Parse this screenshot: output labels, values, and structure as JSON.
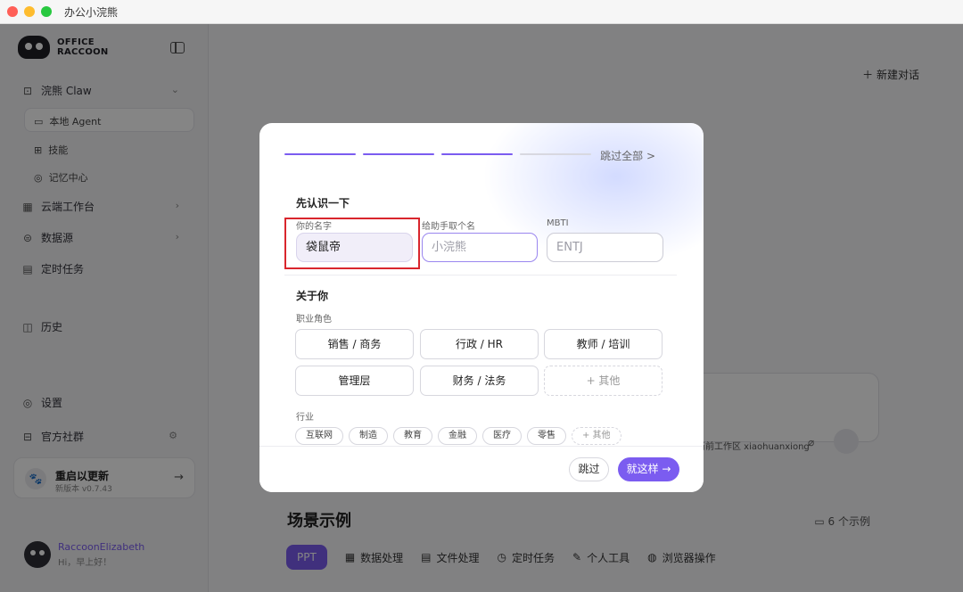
{
  "window": {
    "title": "办公小浣熊"
  },
  "sidebar": {
    "logo": {
      "line1": "OFFICE",
      "line2": "RACCOON"
    },
    "nav": {
      "claw": "浣熊 Claw",
      "local_agent": "本地 Agent",
      "skills": "技能",
      "memory": "记忆中心",
      "cloud": "云端工作台",
      "datasource": "数据源",
      "tasks": "定时任务",
      "history": "历史",
      "settings": "设置",
      "community": "官方社群"
    },
    "update": {
      "title": "重启以更新",
      "subtitle": "新版本 v0.7.43"
    },
    "user": {
      "name": "RaccoonElizabeth",
      "greeting": "Hi，早上好！"
    }
  },
  "main": {
    "new_chat": "新建对话",
    "workspace": "当前工作区 xiaohuanxiong",
    "scenes_title": "场景示例",
    "scenes_count": "6 个示例",
    "scene_tabs": [
      "PPT",
      "数据处理",
      "文件处理",
      "定时任务",
      "个人工具",
      "浏览器操作"
    ]
  },
  "modal": {
    "progress": {
      "done_steps": 3,
      "total_steps": 4
    },
    "skip_all": "跳过全部 >",
    "intro_title": "先认识一下",
    "name_label": "你的名字",
    "name_value": "袋鼠帝",
    "assistant_label": "给助手取个名",
    "assistant_placeholder": "小浣熊",
    "mbti_label": "MBTI",
    "mbti_placeholder": "ENTJ",
    "about_title": "关于你",
    "role_label": "职业角色",
    "roles": [
      "销售 / 商务",
      "行政 / HR",
      "教师 / 培训",
      "管理层",
      "财务 / 法务",
      "+ 其他"
    ],
    "industry_label": "行业",
    "industries": [
      "互联网",
      "制造",
      "教育",
      "金融",
      "医疗",
      "零售",
      "+ 其他"
    ],
    "skip": "跳过",
    "confirm": "就这样 →"
  },
  "colors": {
    "accent": "#7b5cf0",
    "highlight": "#d9262d"
  }
}
